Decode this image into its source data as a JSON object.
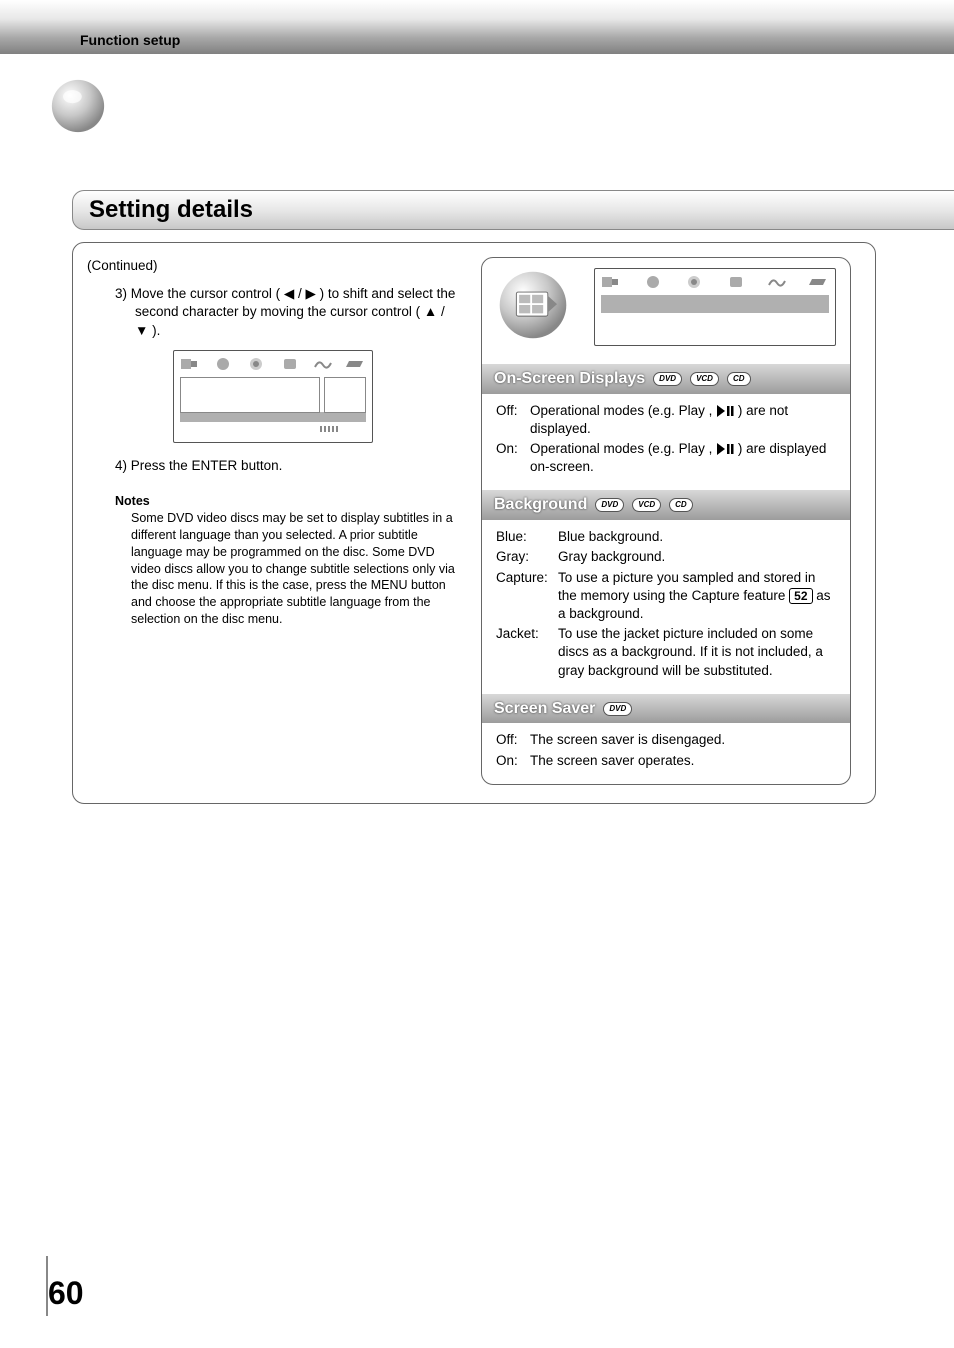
{
  "header": {
    "category": "Function setup"
  },
  "section_title": "Setting details",
  "left": {
    "continued": "(Continued)",
    "step3_num": "3)",
    "step3_text": "Move the cursor control ( ◀ / ▶ ) to shift and select the second character by moving the cursor control ( ▲ / ▼ ).",
    "step4_num": "4)",
    "step4_text": "Press the ENTER button.",
    "notes_title": "Notes",
    "notes_body": "Some DVD video discs may be set to display subtitles in a different language than you selected. A prior subtitle language may be programmed on the disc. Some DVD video discs allow you to change subtitle selections only via the disc menu.  If this is the case, press the MENU button and choose the appropriate subtitle language from the selection on the disc menu."
  },
  "right": {
    "osd": {
      "title": "On-Screen Displays",
      "badges": [
        "DVD",
        "VCD",
        "CD"
      ],
      "off_label": "Off:",
      "off_text_a": "Operational modes (e.g.  Play ,",
      "off_text_b": ") are not displayed.",
      "on_label": "On:",
      "on_text_a": "Operational modes (e.g.  Play ,",
      "on_text_b": ") are displayed on-screen."
    },
    "background": {
      "title": "Background",
      "badges": [
        "DVD",
        "VCD",
        "CD"
      ],
      "rows": [
        {
          "label": "Blue:",
          "text": "Blue background."
        },
        {
          "label": "Gray:",
          "text": "Gray background."
        },
        {
          "label": "Capture:",
          "text_a": "To use a picture you sampled and stored in the memory using the Capture feature",
          "ref": "52",
          "text_b": "as a background."
        },
        {
          "label": "Jacket:",
          "text": "To use the jacket picture included on some discs as a background. If it is not included, a gray background will be substituted."
        }
      ]
    },
    "screensaver": {
      "title": "Screen Saver",
      "badges": [
        "DVD"
      ],
      "off_label": "Off:",
      "off_text": "The screen saver is disengaged.",
      "on_label": "On:",
      "on_text": "The screen saver operates."
    }
  },
  "page_number": "60"
}
